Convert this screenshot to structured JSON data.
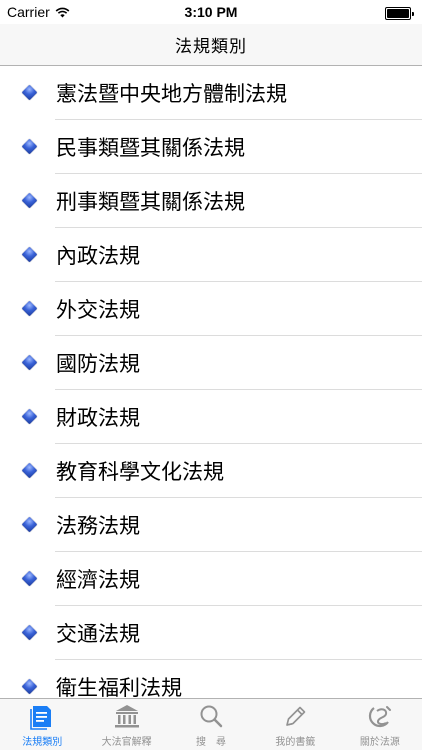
{
  "status_bar": {
    "carrier": "Carrier",
    "time": "3:10 PM"
  },
  "nav": {
    "title": "法規類別"
  },
  "categories": [
    {
      "label": "憲法暨中央地方體制法規"
    },
    {
      "label": "民事類暨其關係法規"
    },
    {
      "label": "刑事類暨其關係法規"
    },
    {
      "label": "內政法規"
    },
    {
      "label": "外交法規"
    },
    {
      "label": "國防法規"
    },
    {
      "label": "財政法規"
    },
    {
      "label": "教育科學文化法規"
    },
    {
      "label": "法務法規"
    },
    {
      "label": "經濟法規"
    },
    {
      "label": "交通法規"
    },
    {
      "label": "衛生福利法規"
    }
  ],
  "tabs": [
    {
      "label": "法規類別",
      "icon": "document-icon",
      "active": true
    },
    {
      "label": "大法官解釋",
      "icon": "courthouse-icon",
      "active": false
    },
    {
      "label": "搜　尋",
      "icon": "magnifier-icon",
      "active": false
    },
    {
      "label": "我的書籤",
      "icon": "pencil-icon",
      "active": false
    },
    {
      "label": "關於法源",
      "icon": "logo-icon",
      "active": false
    }
  ],
  "colors": {
    "accent": "#1a7ef5",
    "inactive": "#929292",
    "bar_bg": "#f7f7f7",
    "separator": "#dcdcdc"
  }
}
